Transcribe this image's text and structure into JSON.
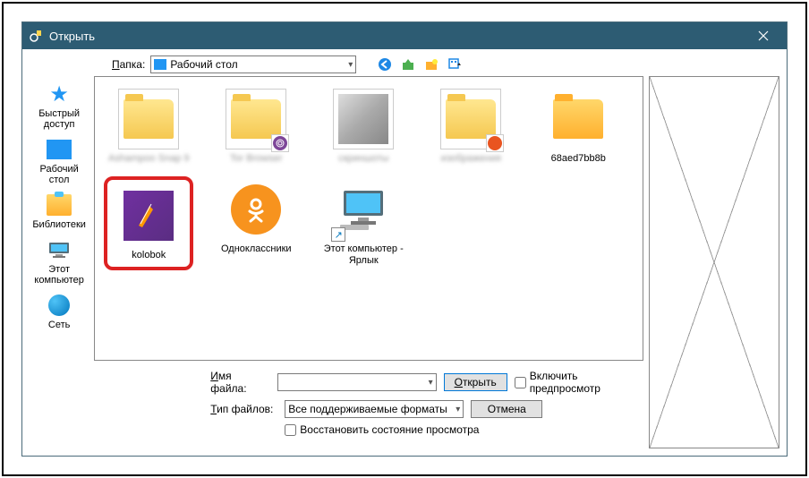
{
  "titlebar": {
    "title": "Открыть"
  },
  "toolbar": {
    "folder_label": "Папка:",
    "current_folder": "Рабочий стол"
  },
  "sidebar": {
    "items": [
      {
        "label": "Быстрый доступ"
      },
      {
        "label": "Рабочий стол"
      },
      {
        "label": "Библиотеки"
      },
      {
        "label": "Этот компьютер"
      },
      {
        "label": "Сеть"
      }
    ]
  },
  "files": {
    "row1": [
      {
        "label": "Ashampoo Snap 9"
      },
      {
        "label": "Tor Browser"
      },
      {
        "label": "скриншоты"
      },
      {
        "label": "изображения"
      }
    ],
    "row2": [
      {
        "label": "68aed7bb8b"
      },
      {
        "label": "kolobok"
      },
      {
        "label": "Одноклассники"
      },
      {
        "label": "Этот компьютер - Ярлык"
      }
    ]
  },
  "bottom": {
    "filename_label": "Имя файла:",
    "filename_value": "",
    "filetype_label": "Тип файлов:",
    "filetype_value": "Все поддерживаемые форматы",
    "open_btn": "Открыть",
    "cancel_btn": "Отмена",
    "restore_state": "Восстановить состояние просмотра",
    "enable_preview": "Включить предпросмотр"
  }
}
